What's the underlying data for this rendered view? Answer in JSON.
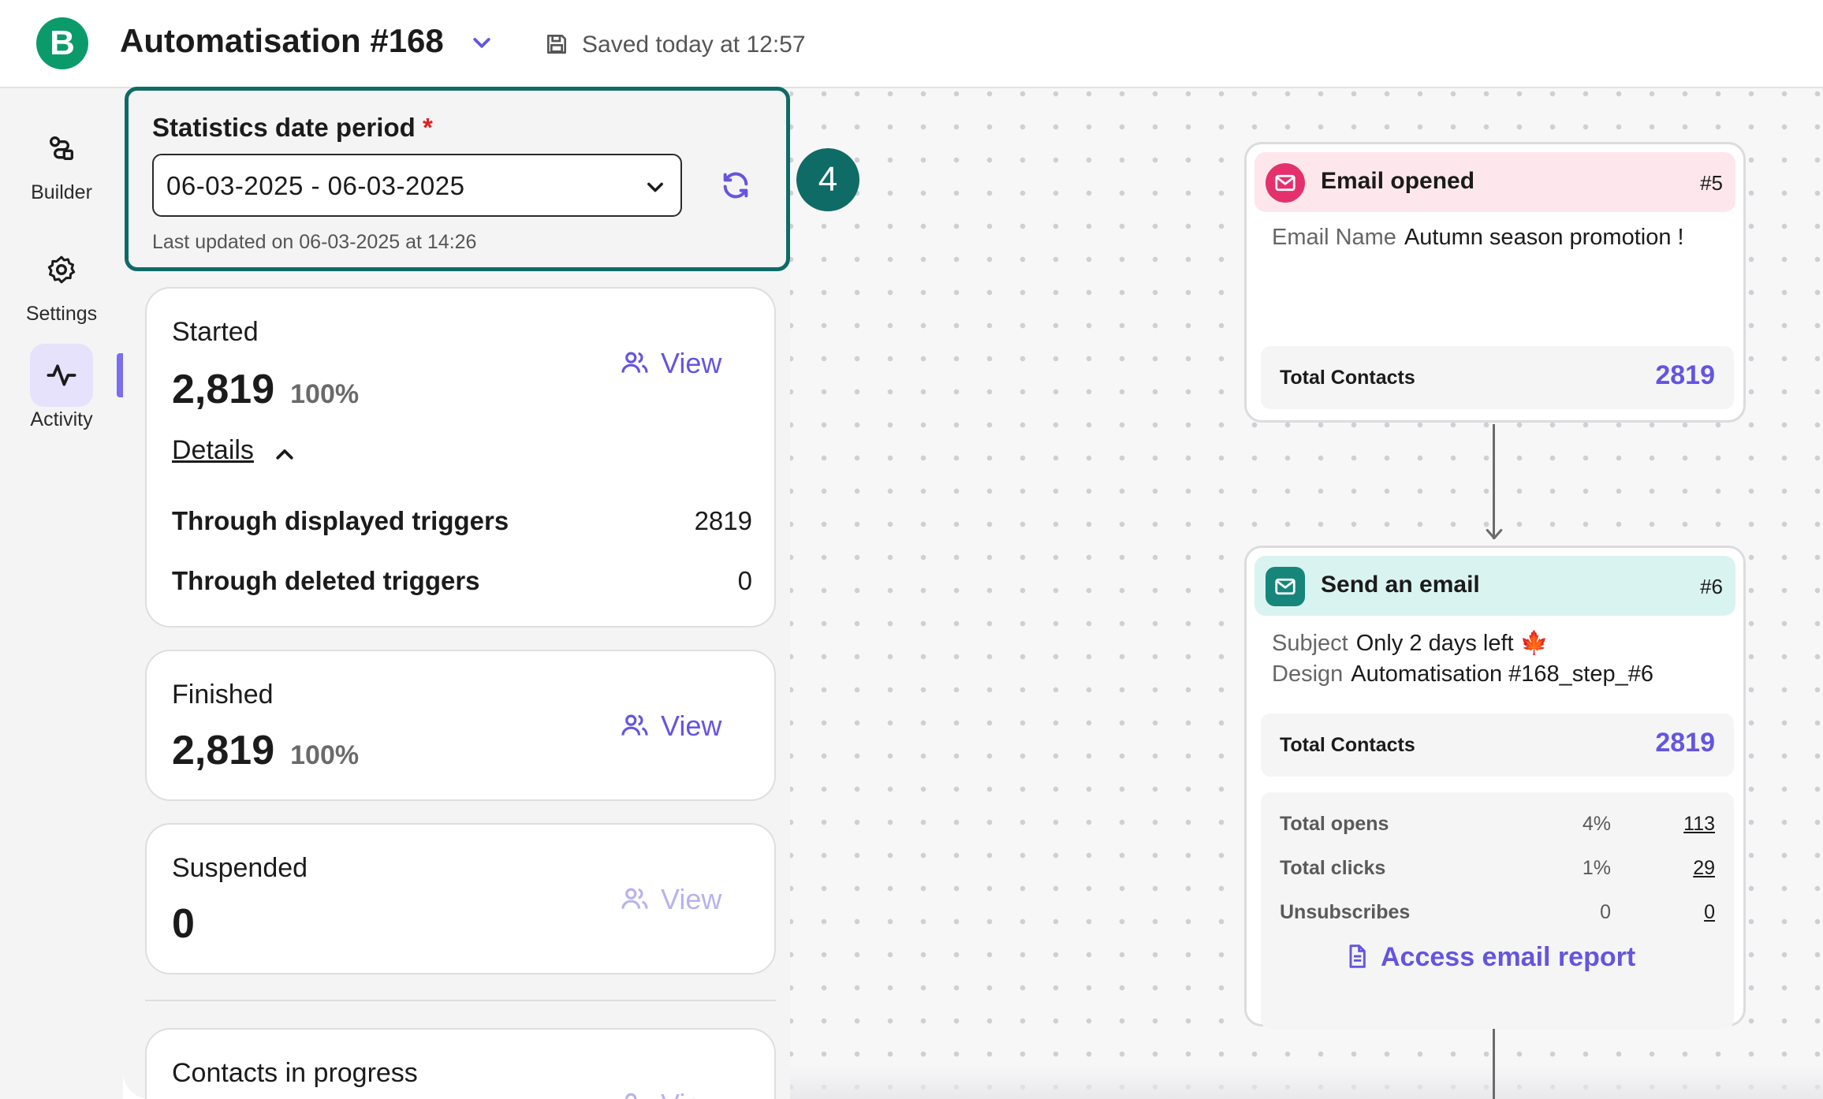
{
  "header": {
    "logo_letter": "B",
    "title": "Automatisation #168",
    "saved_text": "Saved today at 12:57"
  },
  "nav": {
    "items": [
      {
        "label": "Builder",
        "icon": "builder-icon"
      },
      {
        "label": "Settings",
        "icon": "gear-icon"
      },
      {
        "label": "Activity",
        "icon": "activity-icon",
        "active": true
      }
    ]
  },
  "stats": {
    "date_label": "Statistics date period",
    "required_mark": "*",
    "date_range": "06-03-2025 - 06-03-2025",
    "last_updated": "Last updated on 06-03-2025 at 14:26",
    "step_badge": "4",
    "cards": [
      {
        "label": "Started",
        "value": "2,819",
        "percent": "100%",
        "view_label": "View",
        "details_label": "Details",
        "triggers": [
          {
            "label": "Through displayed triggers",
            "value": "2819"
          },
          {
            "label": "Through deleted triggers",
            "value": "0"
          }
        ]
      },
      {
        "label": "Finished",
        "value": "2,819",
        "percent": "100%",
        "view_label": "View"
      },
      {
        "label": "Suspended",
        "value": "0",
        "view_label": "View"
      },
      {
        "label": "Contacts in progress",
        "view_label": "View"
      }
    ]
  },
  "canvas": {
    "nodes": [
      {
        "title": "Email opened",
        "number": "#5",
        "color": "#e4316d",
        "fields": [
          {
            "key": "Email Name",
            "value": "Autumn season promotion !"
          }
        ],
        "total_label": "Total Contacts",
        "total_value": "2819"
      },
      {
        "title": "Send an email",
        "number": "#6",
        "color": "#16867b",
        "fields": [
          {
            "key": "Subject",
            "value": "Only 2 days left 🍁"
          },
          {
            "key": "Design",
            "value": "Automatisation #168_step_#6"
          }
        ],
        "total_label": "Total Contacts",
        "total_value": "2819",
        "metrics": [
          {
            "label": "Total opens",
            "percent": "4%",
            "count": "113"
          },
          {
            "label": "Total clicks",
            "percent": "1%",
            "count": "29"
          },
          {
            "label": "Unsubscribes",
            "percent": "0",
            "count": "0"
          }
        ],
        "report_link": "Access email report"
      }
    ]
  },
  "colors": {
    "brand": "#0b9b6b",
    "accent": "#6455e0",
    "highlight": "#0f6b66"
  }
}
